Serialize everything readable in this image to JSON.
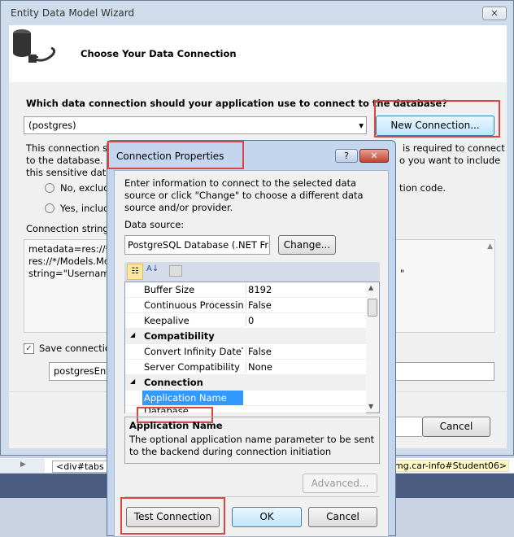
{
  "wizard": {
    "title": "Entity Data Model Wizard",
    "close": "✕",
    "heading": "Choose Your Data Connection",
    "question": "Which data connection should your application use to connect to the database?",
    "connection_selected": "(postgres)",
    "new_connection": "New Connection...",
    "info_line1": "This connection st",
    "info_line1_right": "is required to connect",
    "info_line2": "to the database. St",
    "info_line2_right": "o you want to include",
    "info_line3": "this sensitive data i",
    "radio_no": "No, exclud",
    "radio_no_right": "tion code.",
    "radio_yes": "Yes, includ",
    "conn_string_label": "Connection string:",
    "conn_string_lines": [
      "metadata=res://*/",
      "res://*/Models.Mo",
      "string=\"Username"
    ],
    "conn_string_tail": "\"",
    "save_label": "Save connection",
    "save_checked": true,
    "entity_name": "postgresEntit",
    "cancel": "Cancel"
  },
  "editor": {
    "breadcrumb_left": "<div#tabs",
    "breadcrumb_right": "mg.car-info#Student06>"
  },
  "dialog": {
    "title": "Connection Properties",
    "help": "?",
    "close": "✕",
    "intro": "Enter information to connect to the selected data source or click \"Change\" to choose a different data source and/or provider.",
    "data_source_label": "Data source:",
    "data_source": "PostgreSQL Database (.NET Framework D",
    "change": "Change...",
    "properties": [
      {
        "name": "Buffer Size",
        "value": "8192"
      },
      {
        "name": "Continuous Processing",
        "value": "False"
      },
      {
        "name": "Keepalive",
        "value": "0"
      },
      {
        "category": "Compatibility"
      },
      {
        "name": "Convert Infinity DateTime",
        "value": "False"
      },
      {
        "name": "Server Compatibility Mode",
        "value": "None"
      },
      {
        "category": "Connection"
      },
      {
        "name": "Application Name",
        "value": "",
        "selected": true
      },
      {
        "name": "Database",
        "value": ""
      }
    ],
    "desc_title": "Application Name",
    "desc_text": "The optional application name parameter to be sent to the backend during connection initiation",
    "advanced": "Advanced...",
    "test": "Test Connection",
    "ok": "OK",
    "cancel": "Cancel"
  }
}
